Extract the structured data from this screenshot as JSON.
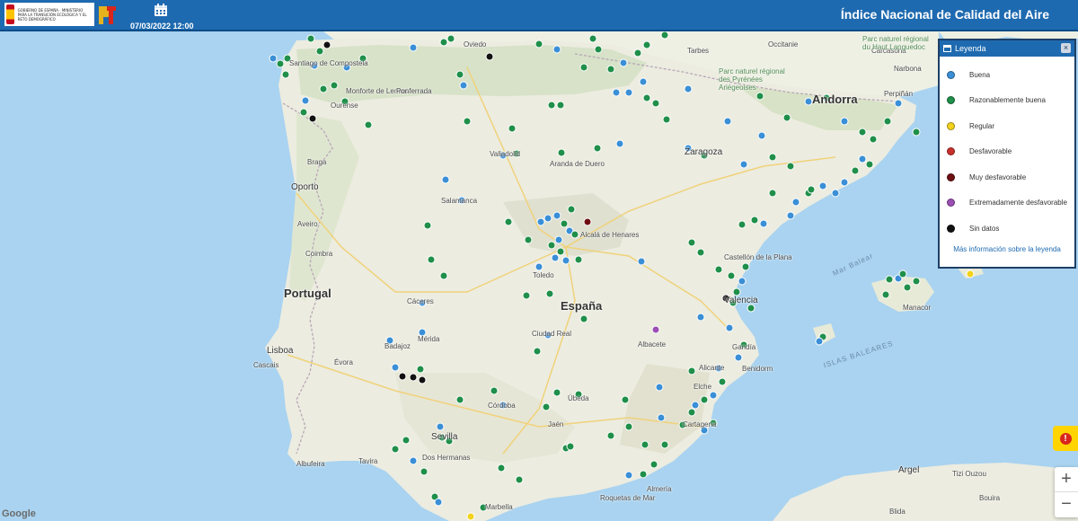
{
  "header": {
    "gov_text": "GOBIERNO DE ESPAÑA · MINISTERIO PARA LA TRANSICIÓN ECOLÓGICA Y EL RETO DEMOGRÁFICO",
    "date": "07/03/2022 12:00",
    "title": "Índice Nacional de Calidad del Aire",
    "icons": [
      "spain-coat-of-arms-icon",
      "prtr-logo-icon",
      "calendar-icon"
    ]
  },
  "legend": {
    "title": "Leyenda",
    "close_label": "×",
    "items": [
      {
        "label": "Buena",
        "color": "#3a8fd6"
      },
      {
        "label": "Razonablemente buena",
        "color": "#1f8f4a"
      },
      {
        "label": "Regular",
        "color": "#f2d21b"
      },
      {
        "label": "Desfavorable",
        "color": "#c9302c"
      },
      {
        "label": "Muy desfavorable",
        "color": "#6e0f12"
      },
      {
        "label": "Extremadamente desfavorable",
        "color": "#9b4fb5"
      },
      {
        "label": "Sin datos",
        "color": "#111111"
      }
    ],
    "more_info": "Más información sobre la leyenda"
  },
  "controls": {
    "zoom_in": "+",
    "zoom_out": "−",
    "alert": "!"
  },
  "map": {
    "attribution": "Google",
    "places": {
      "espana": "España",
      "portugal": "Portugal",
      "andorra": "Andorra",
      "lisboa": "Lisboa",
      "oporto": "Oporto",
      "braga": "Braga",
      "coimbra": "Coimbra",
      "aveiro": "Aveiro",
      "cascais": "Cascais",
      "evora": "Évora",
      "albufeira": "Albufeira",
      "tavira": "Tavira",
      "santiago": "Santiago de Compostela",
      "ourense": "Ourense",
      "monforte": "Monforte de Lemos",
      "ponferrada": "Ponferrada",
      "oviedo": "Oviedo",
      "valladolid": "Valladolid",
      "aranda": "Aranda de Duero",
      "salamanca": "Salamanca",
      "alcala": "Alcalá de Henares",
      "toledo": "Toledo",
      "caceres": "Cáceres",
      "merida": "Mérida",
      "badajoz": "Badajoz",
      "ciudad_real": "Ciudad Real",
      "albacete": "Albacete",
      "zaragoza": "Zaragoza",
      "castellon": "Castellón de la Plana",
      "valencia": "Valencia",
      "gandia": "Gandía",
      "alicante": "Alicante",
      "benidorm": "Benidorm",
      "elche": "Elche",
      "cartagena": "Cartagena",
      "cordoba": "Córdoba",
      "jaen": "Jaén",
      "ubeda": "Úbeda",
      "sevilla": "Sevilla",
      "dos_hermanas": "Dos Hermanas",
      "marbella": "Marbella",
      "almeria": "Almería",
      "roquetas": "Roquetas de Mar",
      "perpinan": "Perpiñán",
      "narbona": "Narbona",
      "carcasona": "Carcasona",
      "tarbes": "Tarbes",
      "manacor": "Manacor",
      "argel": "Argel",
      "tizi_ouzou": "Tizi Ouzou",
      "bouira": "Bouira",
      "blida": "Blida",
      "mar_balear": "Mar Balear",
      "islas_baleares": "ISLAS BALEARES",
      "parc_pyrenees": "Parc naturel régional des Pyrénées Ariégeoises",
      "parc_haut": "Parc naturel régional du Haut Languedoc",
      "occitanie": "Occitanie"
    }
  }
}
